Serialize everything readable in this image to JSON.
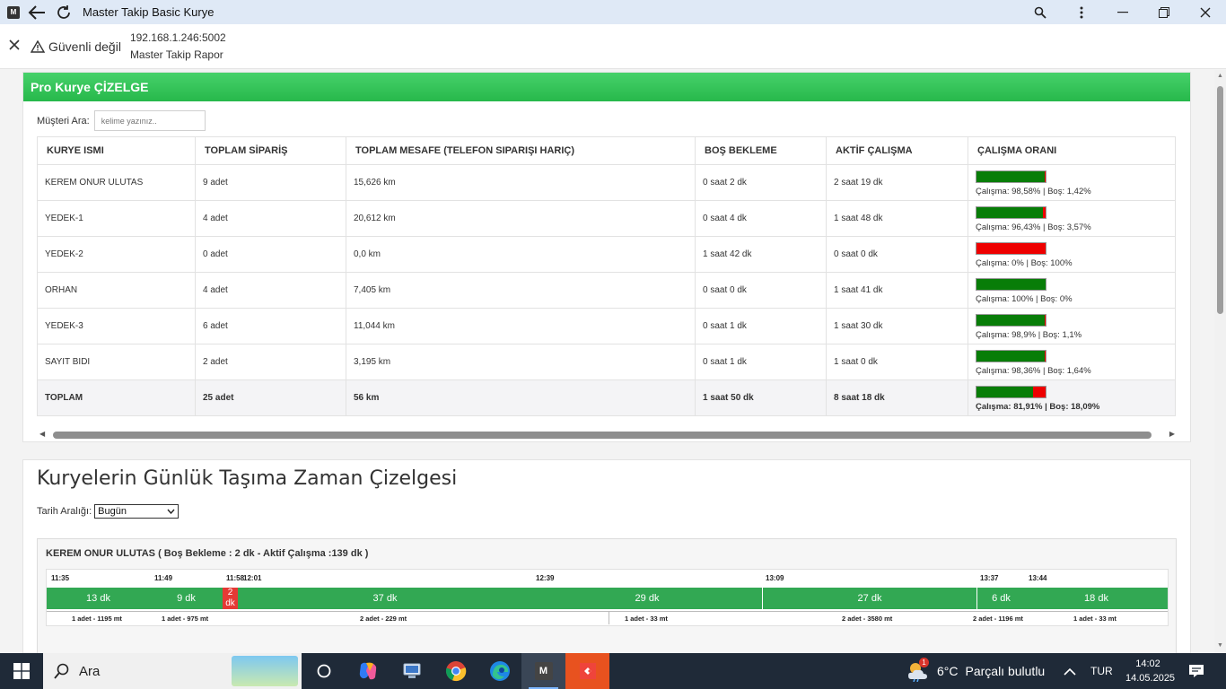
{
  "window": {
    "app_badge": "M",
    "title": "Master Takip Basic Kurye"
  },
  "addressbar": {
    "security": "Güvenli değil",
    "url": "192.168.1.246:5002",
    "page_title": "Master Takip Rapor"
  },
  "card1": {
    "header": "Pro Kurye ÇİZELGE",
    "search_label": "Müşteri Ara:",
    "search_placeholder": "kelime yazınız..",
    "columns": [
      "KURYE ISMI",
      "TOPLAM SİPARİŞ",
      "TOPLAM MESAFE (TELEFON SIPARIŞI HARIÇ)",
      "BOŞ BEKLEME",
      "AKTİF ÇALIŞMA",
      "ÇALIŞMA ORANI"
    ],
    "rows": [
      {
        "name": "KEREM ONUR ULUTAS",
        "orders": "9 adet",
        "distance": "15,626 km",
        "idle": "0 saat 2 dk",
        "active": "2 saat 19 dk",
        "ratio": 98.58,
        "ratio_text": "Çalışma: 98,58% | Boş: 1,42%"
      },
      {
        "name": "YEDEK-1",
        "orders": "4 adet",
        "distance": "20,612 km",
        "idle": "0 saat 4 dk",
        "active": "1 saat 48 dk",
        "ratio": 96.43,
        "ratio_text": "Çalışma: 96,43% | Boş: 3,57%"
      },
      {
        "name": "YEDEK-2",
        "orders": "0 adet",
        "distance": "0,0 km",
        "idle": "1 saat 42 dk",
        "active": "0 saat 0 dk",
        "ratio": 0,
        "ratio_text": "Çalışma: 0% | Boş: 100%"
      },
      {
        "name": "ORHAN",
        "orders": "4 adet",
        "distance": "7,405 km",
        "idle": "0 saat 0 dk",
        "active": "1 saat 41 dk",
        "ratio": 100,
        "ratio_text": "Çalışma: 100% | Boş: 0%"
      },
      {
        "name": "YEDEK-3",
        "orders": "6 adet",
        "distance": "11,044 km",
        "idle": "0 saat 1 dk",
        "active": "1 saat 30 dk",
        "ratio": 98.9,
        "ratio_text": "Çalışma: 98,9% | Boş: 1,1%"
      },
      {
        "name": "SAYIT BIDI",
        "orders": "2 adet",
        "distance": "3,195 km",
        "idle": "0 saat 1 dk",
        "active": "1 saat 0 dk",
        "ratio": 98.36,
        "ratio_text": "Çalışma: 98,36% | Boş: 1,64%"
      }
    ],
    "total": {
      "name": "TOPLAM",
      "orders": "25 adet",
      "distance": "56 km",
      "idle": "1 saat 50 dk",
      "active": "8 saat 18 dk",
      "ratio": 81.91,
      "ratio_text": "Çalışma: 81,91% | Boş: 18,09%"
    }
  },
  "card2": {
    "title": "Kuryelerin Günlük Taşıma Zaman Çizelgesi",
    "date_label": "Tarih Aralığı:",
    "date_value": "Bugün",
    "panel_title": "KEREM ONUR ULUTAS ( Boş Bekleme : 2 dk - Aktif Çalışma :139 dk )",
    "times": [
      "11:35",
      "11:49",
      "11:58",
      "12:01",
      "12:39",
      "13:09",
      "13:37",
      "13:44"
    ],
    "segments": [
      "13 dk",
      "9 dk",
      "2 dk",
      "37 dk",
      "29 dk",
      "27 dk",
      "6 dk",
      "18 dk"
    ],
    "orders": [
      "1 adet - 1195 mt",
      "1 adet - 975 mt",
      "2 adet - 229 mt",
      "1 adet - 33 mt",
      "2 adet - 3580 mt",
      "2 adet - 1196 mt",
      "1 adet - 33 mt"
    ]
  },
  "taskbar": {
    "search_label": "Ara",
    "weather_temp": "6°C",
    "weather_desc": "Parçalı bulutlu",
    "weather_badge": "1",
    "lang": "TUR",
    "time": "14:02",
    "date": "14.05.2025",
    "m_app": "M"
  }
}
